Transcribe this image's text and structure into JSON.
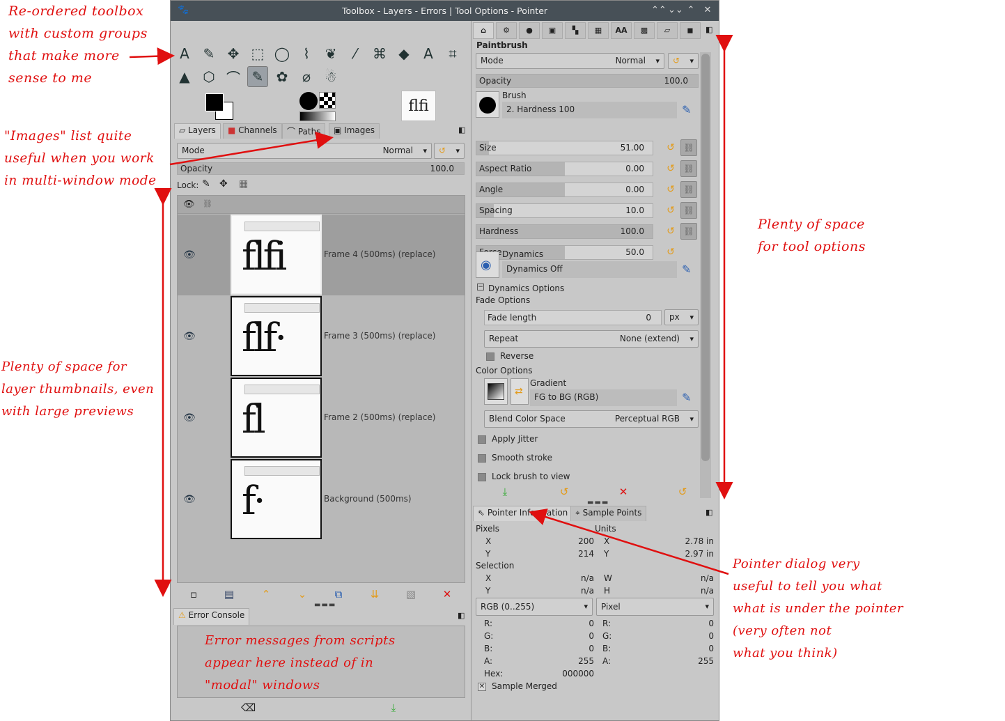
{
  "window": {
    "title": "Toolbox - Layers - Errors | Tool Options - Pointer",
    "buttons": [
      "⌃⌃",
      "⌄⌄",
      "⌃",
      "✕"
    ]
  },
  "toolbox": {
    "row1": [
      "A",
      "✎",
      "✥",
      "⬚",
      "◯",
      "⌇",
      "❦",
      "⁄",
      "⌘",
      "◆",
      "A",
      "⌗"
    ],
    "row2": [
      "▲",
      "⬡",
      "⌒",
      "✎",
      "✿",
      "⌀",
      "☃"
    ]
  },
  "layers_tabs": [
    "Layers",
    "Channels",
    "Paths",
    "Images"
  ],
  "layers": {
    "mode_label": "Mode",
    "mode_value": "Normal",
    "opacity_label": "Opacity",
    "opacity_value": "100.0",
    "lock_label": "Lock:",
    "items": [
      {
        "name": "Frame 4 (500ms) (replace)",
        "glyph": "flfi",
        "selected": true
      },
      {
        "name": "Frame 3 (500ms) (replace)",
        "glyph": "flf·",
        "selected": false
      },
      {
        "name": "Frame 2 (500ms) (replace)",
        "glyph": "fl",
        "selected": false
      },
      {
        "name": "Background (500ms)",
        "glyph": "f·",
        "selected": false
      }
    ]
  },
  "error_console": {
    "tab": "Error Console"
  },
  "tool_options": {
    "tool_name": "Paintbrush",
    "mode_label": "Mode",
    "mode_value": "Normal",
    "opacity_label": "Opacity",
    "opacity_value": "100.0",
    "brush_label": "Brush",
    "brush_value": "2. Hardness 100",
    "sliders": [
      {
        "label": "Size",
        "value": "51.00",
        "fill": 0.07
      },
      {
        "label": "Aspect Ratio",
        "value": "0.00",
        "fill": 0.5
      },
      {
        "label": "Angle",
        "value": "0.00",
        "fill": 0.5
      },
      {
        "label": "Spacing",
        "value": "10.0",
        "fill": 0.1
      },
      {
        "label": "Hardness",
        "value": "100.0",
        "fill": 1.0
      },
      {
        "label": "Force",
        "value": "50.0",
        "fill": 0.5
      }
    ],
    "dynamics_label": "Dynamics",
    "dynamics_value": "Dynamics Off",
    "dynamics_options": "Dynamics Options",
    "fade_options": "Fade Options",
    "fade_length_label": "Fade length",
    "fade_length_value": "0",
    "fade_unit": "px",
    "repeat_label": "Repeat",
    "repeat_value": "None (extend)",
    "reverse": "Reverse",
    "color_options": "Color Options",
    "gradient_label": "Gradient",
    "gradient_value": "FG to BG (RGB)",
    "blend_label": "Blend Color Space",
    "blend_value": "Perceptual RGB",
    "apply_jitter": "Apply Jitter",
    "smooth_stroke": "Smooth stroke",
    "lock_brush": "Lock brush to view"
  },
  "pointer": {
    "tabs": [
      "Pointer Information",
      "Sample Points"
    ],
    "pixels_label": "Pixels",
    "units_label": "Units",
    "x_label": "X",
    "y_label": "Y",
    "x_px": "200",
    "y_px": "214",
    "x_in": "2.78 in",
    "y_in": "2.97 in",
    "selection_label": "Selection",
    "sel_x": "n/a",
    "sel_y": "n/a",
    "w_label": "W",
    "h_label": "H",
    "sel_w": "n/a",
    "sel_h": "n/a",
    "color_mode": "RGB (0..255)",
    "unit_mode": "Pixel",
    "r_label": "R:",
    "g_label": "G:",
    "b_label": "B:",
    "a_label": "A:",
    "r": "0",
    "g": "0",
    "b": "0",
    "a": "255",
    "r2": "0",
    "g2": "0",
    "b2": "0",
    "a2": "255",
    "hex_label": "Hex:",
    "hex": "000000",
    "sample_merged": "Sample Merged"
  },
  "annotations": {
    "toolbox_note": [
      "Re-ordered toolbox",
      "with custom groups",
      "that make more",
      "sense to me"
    ],
    "images_note": [
      "\"Images\" list quite",
      "useful when you work",
      "in multi-window mode"
    ],
    "thumbs_note": [
      "Plenty of space for",
      "layer thumbnails, even",
      "with large previews"
    ],
    "tooloptions_note": [
      "Plenty of space",
      "for tool options"
    ],
    "pointer_note": [
      "Pointer dialog very",
      "useful to tell you what",
      "what is under the pointer",
      "(very often not",
      "what you think)"
    ],
    "error_note": [
      "Error messages from scripts",
      "appear here instead of in",
      "\"modal\" windows"
    ]
  },
  "colors": {
    "annotation": "#e01010",
    "titlebar": "#475057",
    "panel": "#c8c8c8"
  }
}
